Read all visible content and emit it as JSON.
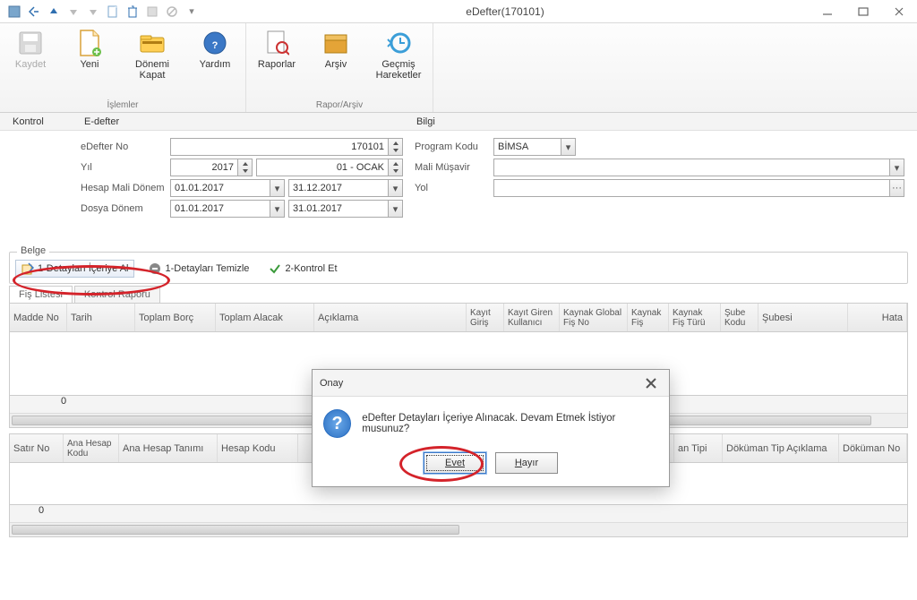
{
  "window": {
    "title": "eDefter(170101)"
  },
  "ribbon": {
    "groups": [
      {
        "title": "İşlemler",
        "items": [
          {
            "label": "Kaydet",
            "icon": "save-icon",
            "disabled": true
          },
          {
            "label": "Yeni",
            "icon": "new-icon",
            "disabled": false
          },
          {
            "label": "Dönemi Kapat",
            "icon": "close-period-icon",
            "disabled": false
          },
          {
            "label": "Yardım",
            "icon": "help-icon",
            "disabled": false
          }
        ]
      },
      {
        "title": "Rapor/Arşiv",
        "items": [
          {
            "label": "Raporlar",
            "icon": "reports-icon"
          },
          {
            "label": "Arşiv",
            "icon": "archive-icon"
          },
          {
            "label": "Geçmiş Hareketler",
            "icon": "history-icon"
          }
        ]
      }
    ]
  },
  "sections": {
    "kontrol": "Kontrol",
    "edefter": "E-defter",
    "bilgi": "Bilgi"
  },
  "form": {
    "edefter_no_label": "eDefter No",
    "edefter_no": "170101",
    "yil_label": "Yıl",
    "yil": "2017",
    "ay": "01 - OCAK",
    "hesap_mali_label": "Hesap Mali Dönem",
    "hesap_bas": "01.01.2017",
    "hesap_bit": "31.12.2017",
    "dosya_donem_label": "Dosya  Dönem",
    "dosya_bas": "01.01.2017",
    "dosya_bit": "31.01.2017",
    "program_kodu_label": "Program Kodu",
    "program_kodu": "BİMSA",
    "mali_musavir_label": "Mali Müşavir",
    "mali_musavir": "",
    "yol_label": "Yol",
    "yol": ""
  },
  "belge": {
    "title": "Belge",
    "btn1": "1-Detayları İçeriye Al",
    "btn2": "1-Detayları Temizle",
    "btn3": "2-Kontrol Et"
  },
  "tabs": {
    "t1": "Fiş Listesi",
    "t2": "Kontrol Raporu"
  },
  "grid1": {
    "cols": [
      "Madde No",
      "Tarih",
      "Toplam Borç",
      "Toplam Alacak",
      "Açıklama",
      "Kayıt Giriş",
      "Kayıt Giren Kullanıcı",
      "Kaynak Global Fiş No",
      "Kaynak Fiş",
      "Kaynak Fiş Türü",
      "Şube Kodu",
      "Şubesi",
      "Hata"
    ],
    "footer_zero": "0"
  },
  "grid2": {
    "cols": [
      "Satır No",
      "Ana Hesap Kodu",
      "Ana Hesap Tanımı",
      "Hesap Kodu",
      "an Tipi",
      "Döküman Tip Açıklama",
      "Döküman No"
    ],
    "footer_zero": "0"
  },
  "dialog": {
    "title": "Onay",
    "message": "eDefter Detayları İçeriye Alınacak. Devam Etmek İstiyor musunuz?",
    "yes": "Evet",
    "no": "Hayır"
  }
}
